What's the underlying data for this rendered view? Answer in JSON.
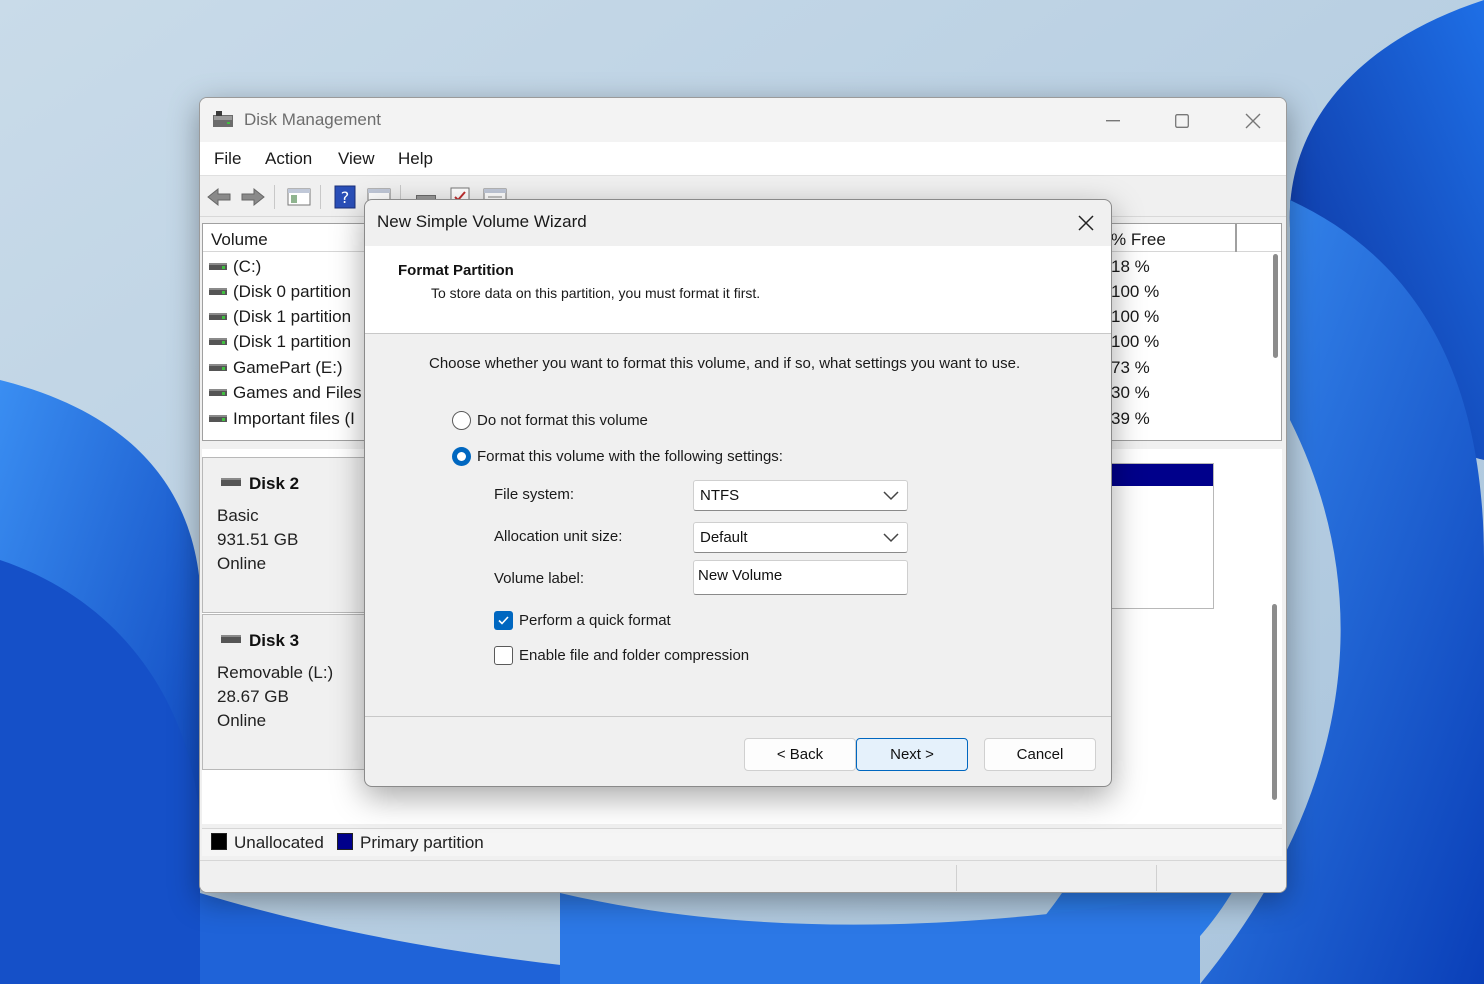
{
  "window": {
    "title": "Disk Management",
    "app_icon": "disk-management-icon",
    "controls": [
      "minimize-icon",
      "maximize-icon",
      "close-icon"
    ]
  },
  "menu": [
    "File",
    "Action",
    "View",
    "Help"
  ],
  "volume_list": {
    "col_volume": "Volume",
    "col_free": "% Free",
    "rows": [
      {
        "name": " (C:)",
        "free": "18 %"
      },
      {
        "name": "(Disk 0 partition",
        "free": "100 %"
      },
      {
        "name": "(Disk 1 partition",
        "free": "100 %"
      },
      {
        "name": "(Disk 1 partition",
        "free": "100 %"
      },
      {
        "name": "GamePart (E:)",
        "free": "73 %"
      },
      {
        "name": "Games and Files",
        "free": "30 %"
      },
      {
        "name": "Important files (I",
        "free": "39 %"
      }
    ]
  },
  "disks": [
    {
      "name": "Disk 2",
      "type": "Basic",
      "size": "931.51 GB",
      "status": "Online"
    },
    {
      "name": "Disk 3",
      "type": "Removable (L:)",
      "size": "28.67 GB",
      "status": "Online"
    }
  ],
  "legend": [
    {
      "label": "Unallocated",
      "color": "#000000"
    },
    {
      "label": "Primary partition",
      "color": "#00008b"
    }
  ],
  "wizard": {
    "title": "New Simple Volume Wizard",
    "header_title": "Format Partition",
    "header_subtitle": "To store data on this partition, you must format it first.",
    "intro": "Choose whether you want to format this volume, and if so, what settings you want to use.",
    "radio_no_format": "Do not format this volume",
    "radio_format": "Format this volume with the following settings:",
    "selected_option": "format",
    "file_system_label": "File system:",
    "file_system_value": "NTFS",
    "alloc_label": "Allocation unit size:",
    "alloc_value": "Default",
    "volume_label_label": "Volume label:",
    "volume_label_value": "New Volume",
    "quick_format_label": "Perform a quick format",
    "quick_format_checked": true,
    "compression_label": "Enable file and folder compression",
    "compression_checked": false,
    "back_label": "< Back",
    "next_label": "Next >",
    "cancel_label": "Cancel"
  },
  "colors": {
    "accent": "#0067c0",
    "wallpaper_blue": "#1a5fd6",
    "primary_partition": "#00008b"
  }
}
